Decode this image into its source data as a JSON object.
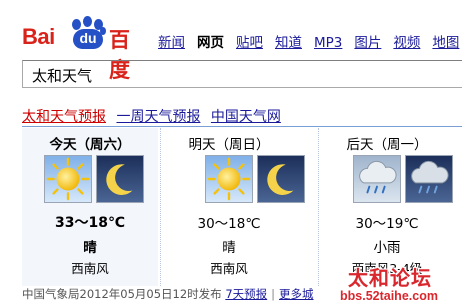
{
  "logo": {
    "part1": "Bai",
    "part2": "du",
    "part3": "百度"
  },
  "nav": [
    {
      "label": "新闻",
      "active": false
    },
    {
      "label": "网页",
      "active": true
    },
    {
      "label": "贴吧",
      "active": false
    },
    {
      "label": "知道",
      "active": false
    },
    {
      "label": "MP3",
      "active": false
    },
    {
      "label": "图片",
      "active": false
    },
    {
      "label": "视频",
      "active": false
    },
    {
      "label": "地图",
      "active": false
    }
  ],
  "search": {
    "value": "太和天气"
  },
  "tabs": [
    {
      "label": "太和天气预报",
      "active": true
    },
    {
      "label": "一周天气预报",
      "active": false
    },
    {
      "label": "中国天气网",
      "active": false
    }
  ],
  "days": [
    {
      "name": "今天（周六）",
      "icons": [
        "sun-icon",
        "moon-icon"
      ],
      "temp": "33～18℃",
      "condition": "晴",
      "wind": "西南风"
    },
    {
      "name": "明天（周日）",
      "icons": [
        "sun-icon",
        "moon-icon"
      ],
      "temp": "30～18℃",
      "condition": "晴",
      "wind": "西南风"
    },
    {
      "name": "后天（周一）",
      "icons": [
        "rain-cloud-day-icon",
        "rain-cloud-night-icon"
      ],
      "temp": "30～19℃",
      "condition": "小雨",
      "wind": "西南风3-4级"
    }
  ],
  "footer": {
    "source": "中国气象局2012年05月05日12时发布",
    "forecast_link": "7天预报",
    "more_link": "更多城"
  },
  "watermark": {
    "title": "太和论坛",
    "url": "bbs.52taihe.com"
  },
  "colors": {
    "brand_red": "#d8221a",
    "brand_blue": "#2550c6",
    "link": "#1a1a9a",
    "active_tab": "#cc0000"
  }
}
